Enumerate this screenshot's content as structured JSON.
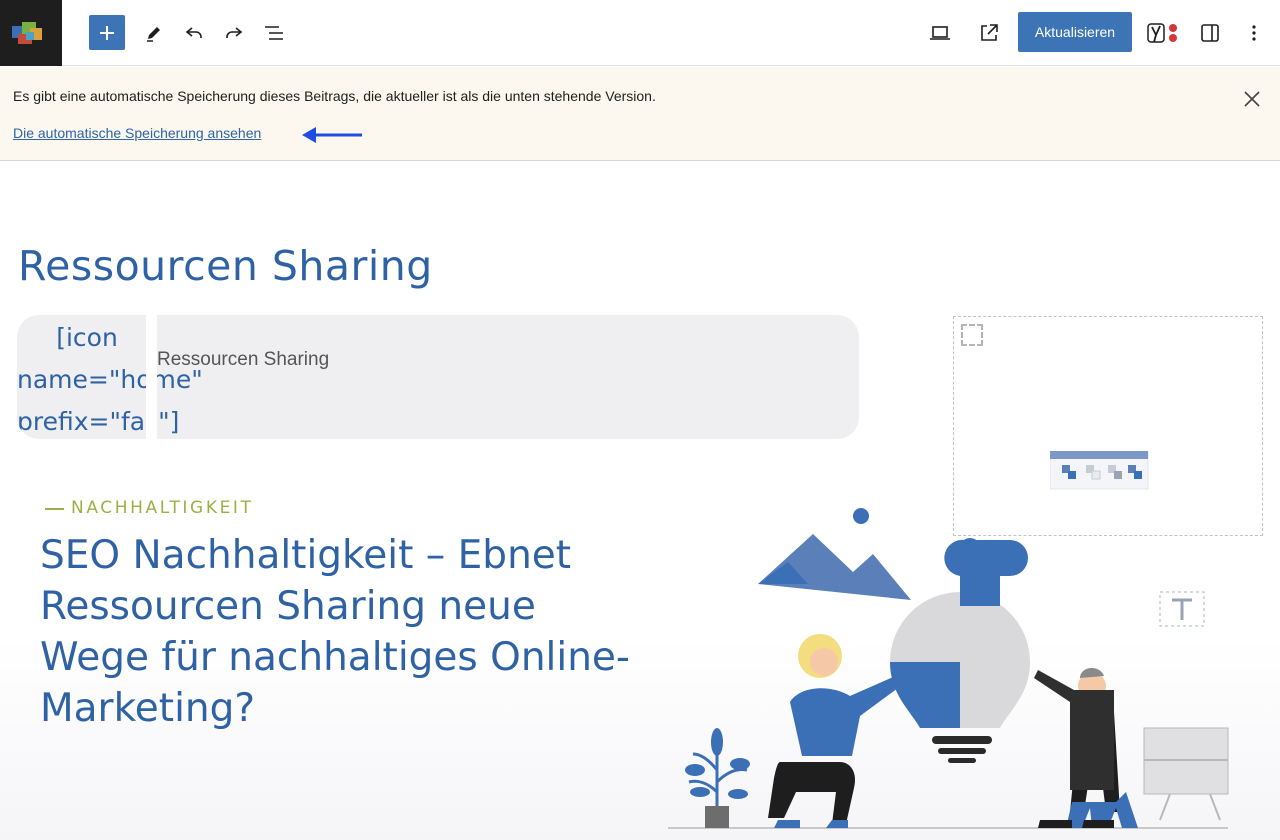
{
  "toolbar": {
    "update_label": "Aktualisieren"
  },
  "notice": {
    "message": "Es gibt eine automatische Speicherung dieses Beitrags, die aktueller ist als die unten stehende Version.",
    "link": "Die automatische Speicherung ansehen"
  },
  "post": {
    "title": "Ressourcen Sharing",
    "shortcode_lines": [
      "[icon",
      "name=\"home\"",
      "prefix=\"fas\"]"
    ],
    "shortcode_label": "Ressourcen Sharing",
    "overline": "NACHHALTIGKEIT",
    "headline": "SEO Nachhaltigkeit – Ebnet Ressourcen Sharing neue Wege für nachhaltiges Online-Marketing?"
  },
  "colors": {
    "accent": "#3d74b5",
    "heading": "#2f62a5",
    "overline": "#9db046",
    "notice_bg": "#fcf8ef"
  },
  "icons": [
    "site-logo",
    "plus-icon",
    "pencil-icon",
    "undo-icon",
    "redo-icon",
    "list-view-icon",
    "preview-laptop-icon",
    "external-link-icon",
    "yoast-icon",
    "sidebar-toggle-icon",
    "more-options-icon",
    "close-icon",
    "arrow-left-icon"
  ]
}
